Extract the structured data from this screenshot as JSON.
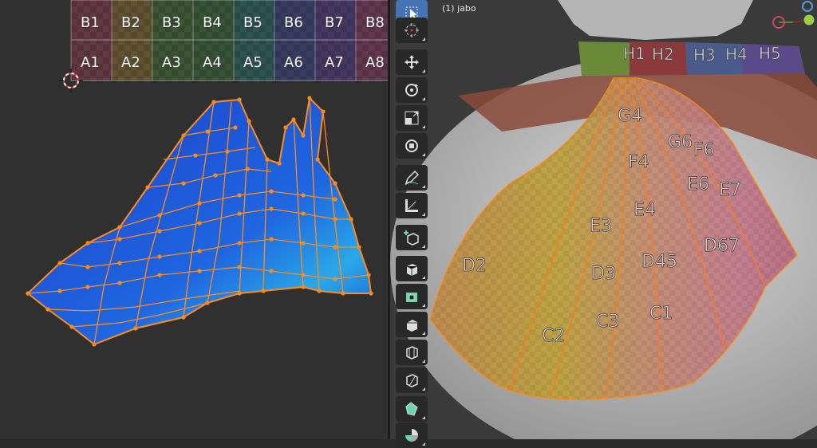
{
  "uv_editor": {
    "grid_row_top": [
      "B1",
      "B2",
      "B3",
      "B4",
      "B5",
      "B6",
      "B7",
      "B8"
    ],
    "grid_row_bottom": [
      "A1",
      "A2",
      "A3",
      "A4",
      "A5",
      "A6",
      "A7",
      "A8"
    ],
    "column_colors": [
      "#6b3a45",
      "#6b5a32",
      "#3f5a35",
      "#3a5a3a",
      "#2f5a5a",
      "#3a3f6b",
      "#4a3a6b",
      "#6b3a55"
    ]
  },
  "viewport": {
    "object_label": "(1) jabo",
    "collar_labels": [
      "H5",
      "H3",
      "H2",
      "H1",
      "H4"
    ],
    "skirt_labels": [
      "G4",
      "G6",
      "F4",
      "F6",
      "E3",
      "E4",
      "E7",
      "E6",
      "D3",
      "D45",
      "D67",
      "C2",
      "C3",
      "D2",
      "C1"
    ]
  },
  "toolbar": {
    "tools": [
      {
        "name": "select-box-tool",
        "icon": "cursor-box-icon",
        "active": true
      },
      {
        "name": "cursor-tool",
        "icon": "crosshair-icon"
      },
      {
        "name": "move-tool",
        "icon": "move-arrows-icon"
      },
      {
        "name": "rotate-tool",
        "icon": "rotate-icon"
      },
      {
        "name": "scale-tool",
        "icon": "scale-icon"
      },
      {
        "name": "transform-tool",
        "icon": "transform-icon"
      },
      {
        "name": "annotate-tool",
        "icon": "pencil-icon"
      },
      {
        "name": "measure-tool",
        "icon": "ruler-icon"
      },
      {
        "name": "add-cube-tool",
        "icon": "add-cube-icon"
      },
      {
        "name": "extrude-tool",
        "icon": "extrude-icon"
      },
      {
        "name": "inset-tool",
        "icon": "inset-icon"
      },
      {
        "name": "bevel-tool",
        "icon": "bevel-icon"
      },
      {
        "name": "loop-cut-tool",
        "icon": "loop-cut-icon"
      },
      {
        "name": "knife-tool",
        "icon": "knife-icon"
      },
      {
        "name": "poly-build-tool",
        "icon": "poly-build-icon"
      },
      {
        "name": "spin-tool",
        "icon": "spin-icon"
      }
    ]
  },
  "colors": {
    "accent": "#4772b3",
    "uv_edge": "#ff8c1a",
    "uv_face": "#1f55d4"
  }
}
